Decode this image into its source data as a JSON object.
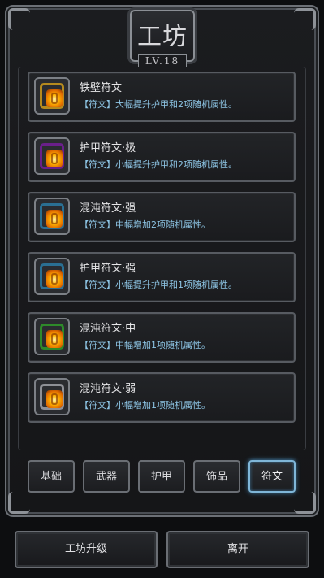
{
  "header": {
    "title": "工坊",
    "level": "LV.18"
  },
  "runes": [
    {
      "name": "铁壁符文",
      "desc": "【符文】大幅提升护甲和2项随机属性。",
      "frame_color": "#b58a1e"
    },
    {
      "name": "护甲符文·极",
      "desc": "【符文】小幅提升护甲和2项随机属性。",
      "frame_color": "#6a1f8a"
    },
    {
      "name": "混沌符文·强",
      "desc": "【符文】中幅增加2项随机属性。",
      "frame_color": "#2a6f92"
    },
    {
      "name": "护甲符文·强",
      "desc": "【符文】小幅提升护甲和1项随机属性。",
      "frame_color": "#2a6f92"
    },
    {
      "name": "混沌符文·中",
      "desc": "【符文】中幅增加1项随机属性。",
      "frame_color": "#2e8a2a"
    },
    {
      "name": "混沌符文·弱",
      "desc": "【符文】小幅增加1项随机属性。",
      "frame_color": "#8e9096"
    }
  ],
  "tabs": [
    {
      "label": "基础"
    },
    {
      "label": "武器"
    },
    {
      "label": "护甲"
    },
    {
      "label": "饰品"
    },
    {
      "label": "符文",
      "active": true
    }
  ],
  "buttons": {
    "upgrade": "工坊升级",
    "leave": "离开"
  },
  "colors": {
    "desc_text": "#8ec6e6",
    "active_tab_glow": "#7fb6d8"
  }
}
